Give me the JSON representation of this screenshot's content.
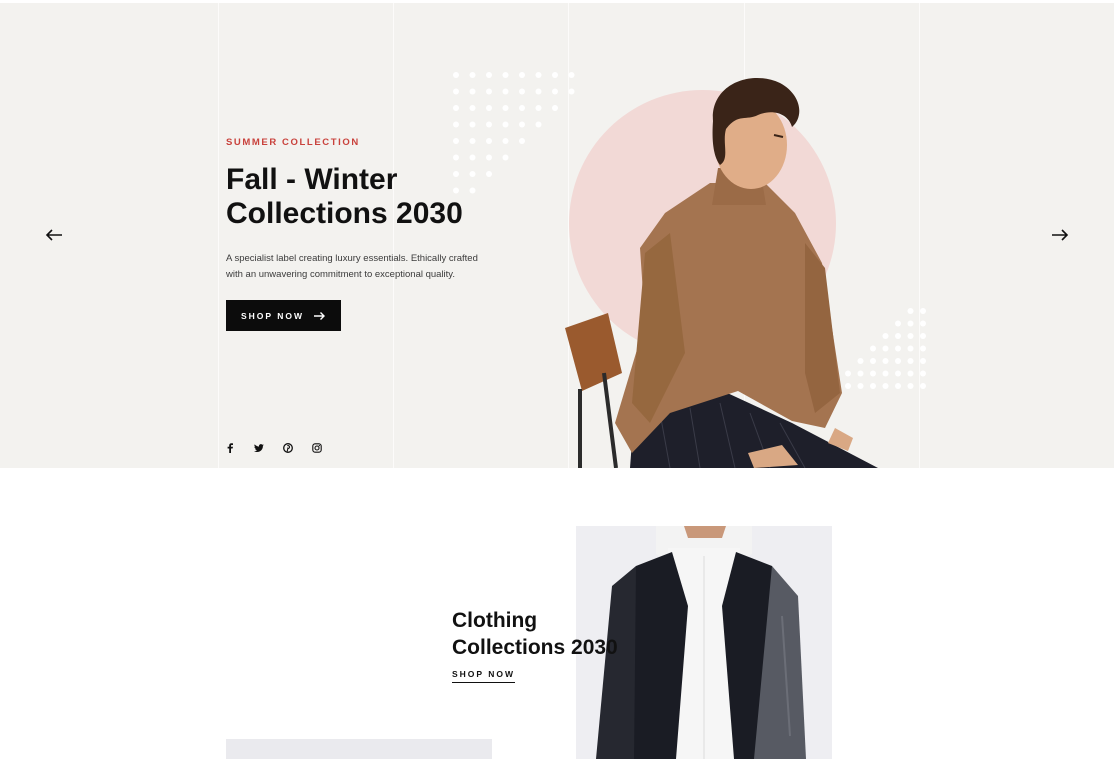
{
  "hero": {
    "kicker": "SUMMER COLLECTION",
    "title_line1": "Fall - Winter",
    "title_line2": "Collections 2030",
    "desc_line1": "A specialist label creating luxury essentials. Ethically crafted",
    "desc_line2": "with an unwavering commitment to exceptional quality.",
    "button_label": "SHOP NOW",
    "prev_icon": "arrow-left-icon",
    "next_icon": "arrow-right-icon",
    "background_color": "#f3f2ef",
    "accent_color": "#c9423c",
    "circle_color": "#f2d9d6"
  },
  "socials": [
    {
      "icon": "facebook-icon",
      "glyph": "f"
    },
    {
      "icon": "twitter-icon",
      "glyph": "t"
    },
    {
      "icon": "pinterest-icon",
      "glyph": "p"
    },
    {
      "icon": "instagram-icon",
      "glyph": "ig"
    }
  ],
  "banner": {
    "title_line1": "Clothing",
    "title_line2": "Collections 2030",
    "link_label": "SHOP NOW"
  }
}
